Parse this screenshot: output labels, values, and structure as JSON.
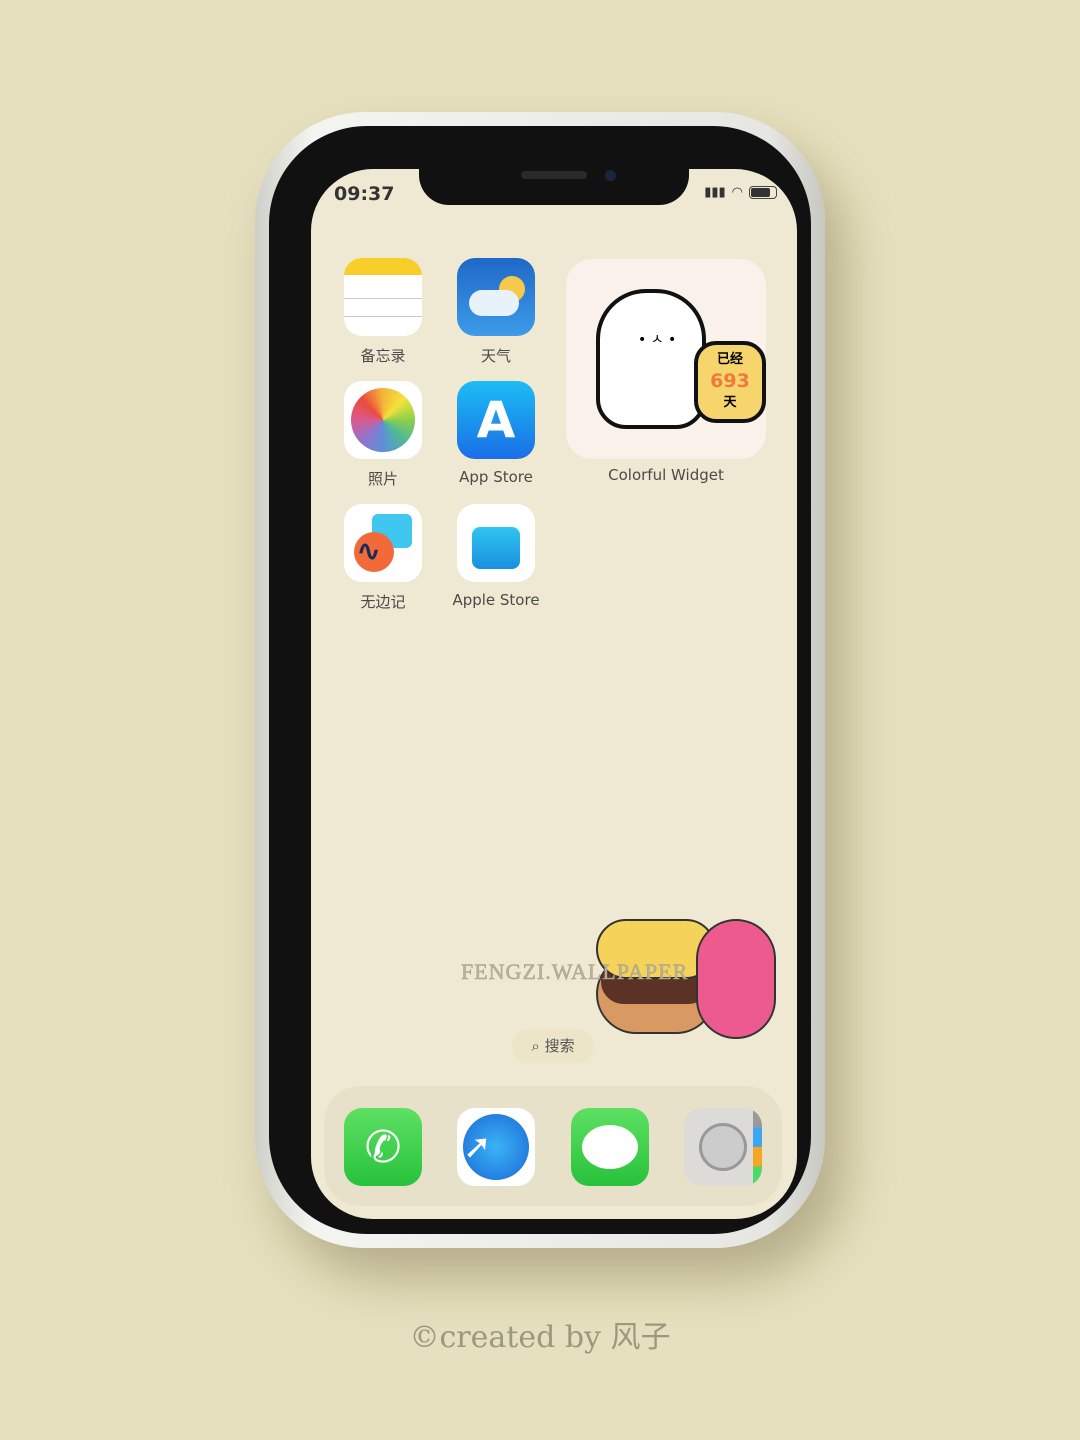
{
  "status_bar": {
    "time": "09:37",
    "signal": "signal-icon",
    "wifi": "wifi-icon",
    "battery_level": 0.8
  },
  "apps": [
    {
      "label": "备忘录",
      "icon": "notes-icon"
    },
    {
      "label": "天气",
      "icon": "weather-icon"
    },
    {
      "label": "照片",
      "icon": "photos-icon"
    },
    {
      "label": "App Store",
      "icon": "app-store-icon"
    },
    {
      "label": "无边记",
      "icon": "freeform-icon"
    },
    {
      "label": "Apple Store",
      "icon": "apple-store-icon"
    }
  ],
  "widget": {
    "label": "Colorful Widget",
    "line1": "已经",
    "count": "693",
    "line2": "天"
  },
  "wallpaper_watermark": "FENGZI.WALLPAPER",
  "search": {
    "label": "搜索",
    "icon": "search-icon"
  },
  "dock": [
    {
      "icon": "phone-icon"
    },
    {
      "icon": "safari-icon"
    },
    {
      "icon": "messages-icon"
    },
    {
      "icon": "contacts-icon"
    }
  ],
  "credit": "©created by 风子"
}
